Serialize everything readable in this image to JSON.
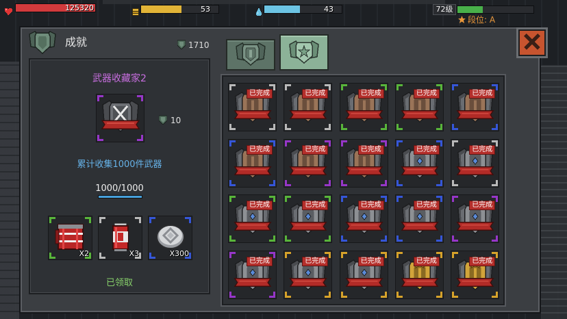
{
  "hud": {
    "health": {
      "value": "125320",
      "fill": 1.0,
      "color": "#d23a3c",
      "icon": "heart-icon"
    },
    "energy": {
      "value": "53",
      "fill": 0.52,
      "color": "#e2b437",
      "icon": "coin-icon"
    },
    "mana": {
      "value": "43",
      "fill": 0.46,
      "color": "#6cc4e4",
      "icon": "droplet-icon"
    },
    "level": {
      "label": "72级",
      "fill": 0.33,
      "color": "#49b04a"
    },
    "rank": {
      "label": "段位: A",
      "icon": "star-icon",
      "color": "#e8963a"
    }
  },
  "panel": {
    "title": "成就",
    "title_icon": "achievement-shield-icon",
    "currency": "1710",
    "currency_icon": "shield-token-icon",
    "tabs": [
      {
        "icon": "winged-shield-emblem-icon",
        "selected": false
      },
      {
        "icon": "star-shield-emblem-icon",
        "selected": true
      }
    ],
    "close_icon": "close-icon"
  },
  "detail": {
    "name": "武器收藏家2",
    "rarity": "purple",
    "badge_icon": "crossed-swords-badge-icon",
    "reward_tokens": "10",
    "description": "累计收集1000件武器",
    "progress_text": "1000/1000",
    "progress": 1.0,
    "rewards": [
      {
        "icon": "red-supply-crate-icon",
        "qty": "X2",
        "rarity": "green"
      },
      {
        "icon": "red-soda-can-icon",
        "qty": "X3",
        "rarity": "gray"
      },
      {
        "icon": "silver-coin-icon",
        "qty": "X300",
        "rarity": "blue"
      }
    ],
    "status": "已领取"
  },
  "rarity_colors": {
    "gray": "#b9b9b9",
    "green": "#58b53a",
    "blue": "#3556d8",
    "purple": "#9636c8",
    "gold": "#d6a22a"
  },
  "tier_colors": {
    "bronze": [
      "#9a7458",
      "#6a4e3c"
    ],
    "silver": [
      "#8d9094",
      "#5a5d62"
    ],
    "gold": [
      "#d2a43a",
      "#8a6a22"
    ]
  },
  "grid": [
    {
      "status": "已完成",
      "rarity": "gray",
      "tier": "bronze"
    },
    {
      "status": "已完成",
      "rarity": "gray",
      "tier": "bronze"
    },
    {
      "status": "已完成",
      "rarity": "green",
      "tier": "bronze"
    },
    {
      "status": "已完成",
      "rarity": "green",
      "tier": "bronze"
    },
    {
      "status": "已完成",
      "rarity": "blue",
      "tier": "bronze"
    },
    {
      "status": "已完成",
      "rarity": "blue",
      "tier": "bronze"
    },
    {
      "status": "已完成",
      "rarity": "purple",
      "tier": "bronze"
    },
    {
      "status": "已完成",
      "rarity": "purple",
      "tier": "bronze"
    },
    {
      "status": "已完成",
      "rarity": "blue",
      "tier": "silver"
    },
    {
      "status": "已完成",
      "rarity": "gray",
      "tier": "silver"
    },
    {
      "status": "已完成",
      "rarity": "green",
      "tier": "silver"
    },
    {
      "status": "已完成",
      "rarity": "green",
      "tier": "silver"
    },
    {
      "status": "已完成",
      "rarity": "blue",
      "tier": "silver"
    },
    {
      "status": "已完成",
      "rarity": "blue",
      "tier": "silver"
    },
    {
      "status": "已完成",
      "rarity": "purple",
      "tier": "silver"
    },
    {
      "status": "已完成",
      "rarity": "purple",
      "tier": "silver"
    },
    {
      "status": "已完成",
      "rarity": "gold",
      "tier": "silver"
    },
    {
      "status": "已完成",
      "rarity": "gold",
      "tier": "silver"
    },
    {
      "status": "已完成",
      "rarity": "gold",
      "tier": "gold"
    },
    {
      "status": "已完成",
      "rarity": "gold",
      "tier": "gold"
    }
  ]
}
